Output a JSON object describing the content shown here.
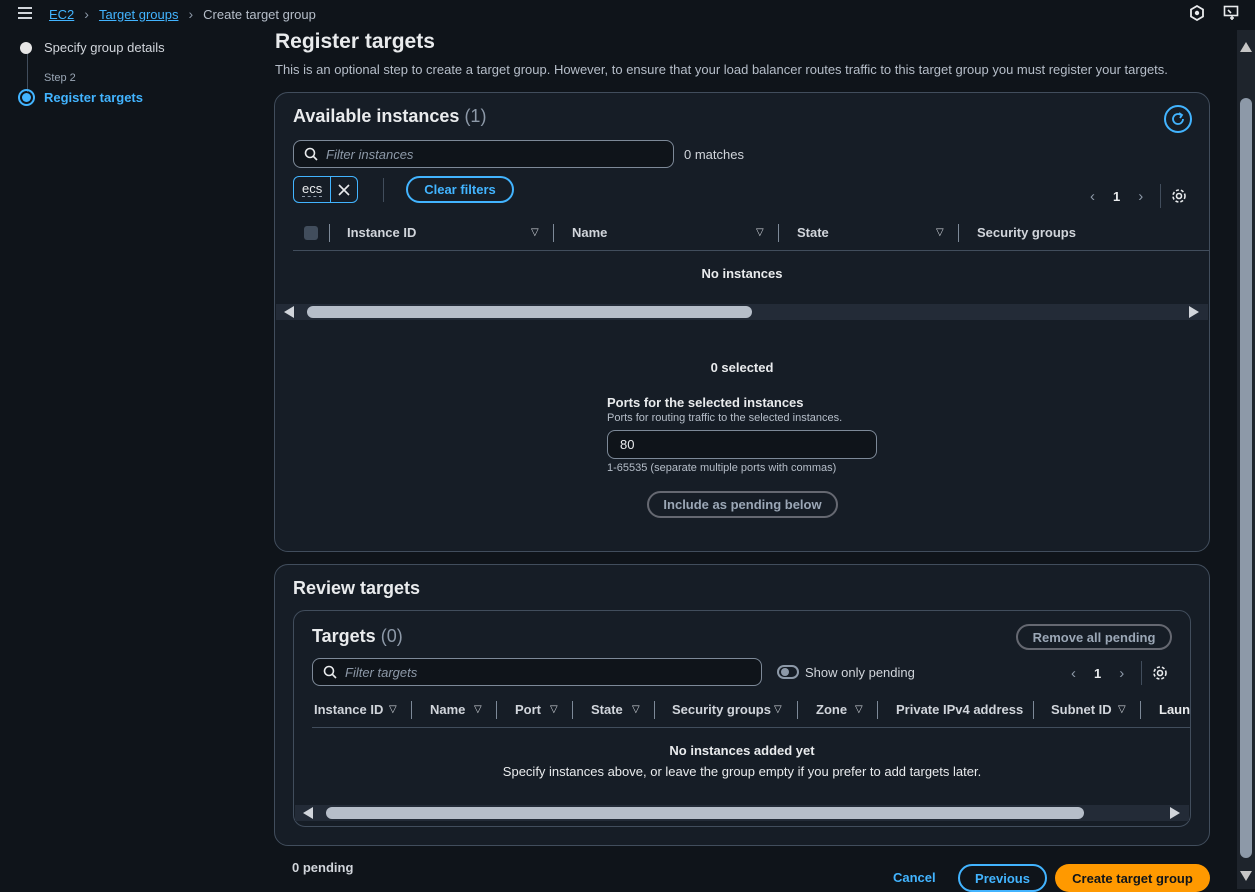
{
  "breadcrumb": {
    "items": [
      "EC2",
      "Target groups"
    ],
    "current": "Create target group"
  },
  "steps": {
    "step1_label": "Specify group details",
    "step2_caption": "Step 2",
    "step2_label": "Register targets"
  },
  "page": {
    "title": "Register targets",
    "description": "This is an optional step to create a target group. However, to ensure that your load balancer routes traffic to this target group you must register your targets."
  },
  "available": {
    "title": "Available instances",
    "count": "(1)",
    "filter_placeholder": "Filter instances",
    "matches": "0 matches",
    "token": "ecs",
    "clear_filters": "Clear filters",
    "page": "1",
    "columns": [
      "Instance ID",
      "Name",
      "State",
      "Security groups"
    ],
    "empty": "No instances",
    "selected": "0 selected",
    "ports_label": "Ports for the selected instances",
    "ports_desc": "Ports for routing traffic to the selected instances.",
    "ports_value": "80",
    "ports_hint": "1-65535 (separate multiple ports with commas)",
    "include_button": "Include as pending below"
  },
  "review": {
    "title": "Review targets",
    "targets_title": "Targets",
    "targets_count": "(0)",
    "remove_all": "Remove all pending",
    "filter_placeholder": "Filter targets",
    "show_only_pending": "Show only pending",
    "page": "1",
    "columns": [
      "Instance ID",
      "Name",
      "Port",
      "State",
      "Security groups",
      "Zone",
      "Private IPv4 address",
      "Subnet ID",
      "Laun"
    ],
    "empty_title": "No instances added yet",
    "empty_desc": "Specify instances above, or leave the group empty if you prefer to add targets later."
  },
  "footer": {
    "pending": "0 pending",
    "cancel": "Cancel",
    "previous": "Previous",
    "create": "Create target group"
  },
  "colors": {
    "accent": "#42b4ff",
    "primary": "#ff9900",
    "background": "#0f141a"
  }
}
